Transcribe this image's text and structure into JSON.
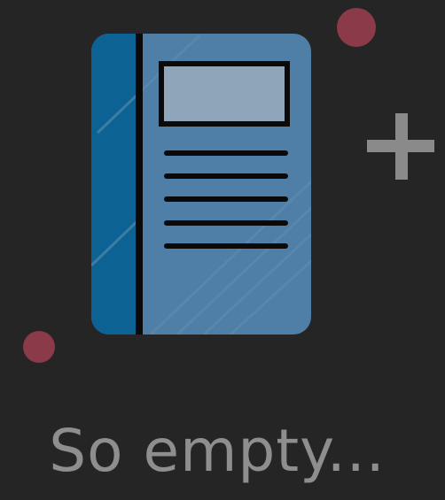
{
  "empty_state": {
    "message": "So empty...",
    "icon": "notebook-icon",
    "decorations": [
      "plus-icon",
      "dot-icon",
      "dot-icon"
    ]
  },
  "colors": {
    "background": "#252525",
    "notebook_cover": "#4f7ea6",
    "notebook_spine": "#0d6294",
    "notebook_label": "#8fa6ba",
    "outline": "#0a0a0a",
    "plus": "#8a8a8a",
    "dot": "#8a3a48",
    "text": "#8e8e8e"
  }
}
